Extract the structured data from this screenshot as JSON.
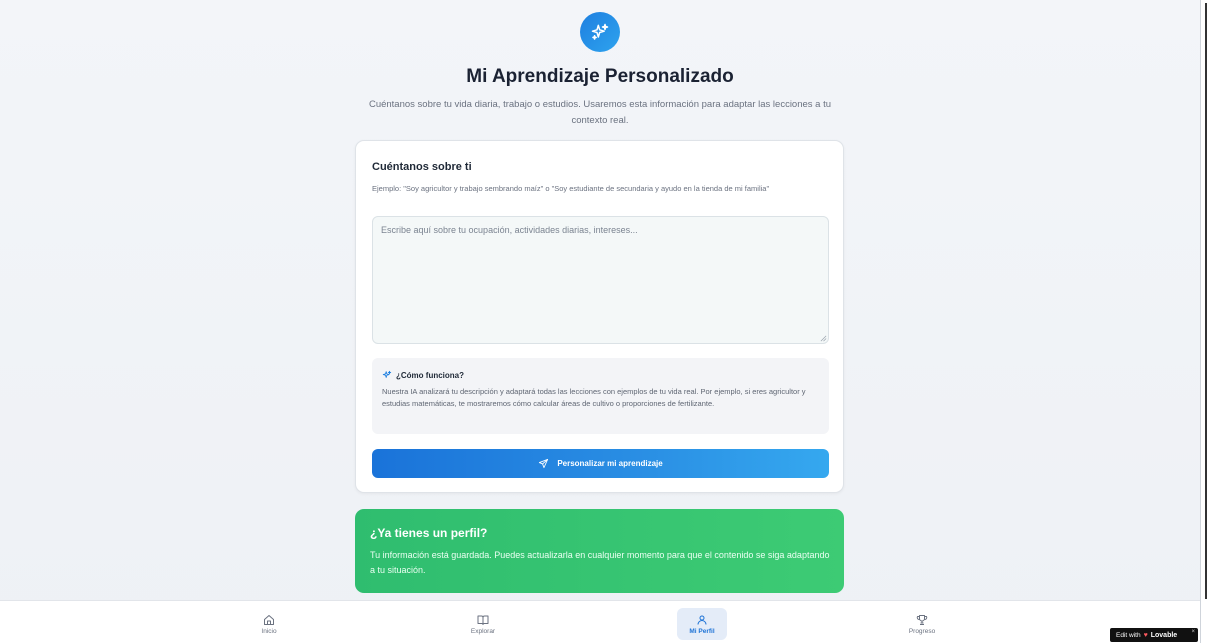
{
  "header": {
    "title": "Mi Aprendizaje Personalizado",
    "subtitle": "Cuéntanos sobre tu vida diaria, trabajo o estudios. Usaremos esta información para adaptar las lecciones a tu contexto real."
  },
  "form": {
    "title": "Cuéntanos sobre ti",
    "hint": "Ejemplo: \"Soy agricultor y trabajo sembrando maíz\" o \"Soy estudiante de secundaria y ayudo en la tienda de mi familia\"",
    "textarea_placeholder": "Escribe aquí sobre tu ocupación, actividades diarias, intereses...",
    "textarea_value": "",
    "info": {
      "title": "¿Cómo funciona?",
      "body": "Nuestra IA analizará tu descripción y adaptará todas las lecciones con ejemplos de tu vida real. Por ejemplo, si eres agricultor y estudias matemáticas, te mostraremos cómo calcular áreas de cultivo o proporciones de fertilizante."
    },
    "submit_label": "Personalizar mi aprendizaje"
  },
  "profile_card": {
    "title": "¿Ya tienes un perfil?",
    "body": "Tu información está guardada. Puedes actualizarla en cualquier momento para que el contenido se siga adaptando a tu situación."
  },
  "bottom_nav": {
    "items": [
      {
        "label": "Inicio",
        "icon": "home-icon",
        "active": false
      },
      {
        "label": "Explorar",
        "icon": "book-icon",
        "active": false
      },
      {
        "label": "Mi Perfil",
        "icon": "user-icon",
        "active": true
      },
      {
        "label": "Progreso",
        "icon": "trophy-icon",
        "active": false
      }
    ]
  },
  "badge": {
    "prefix": "Edit with",
    "brand": "Lovable",
    "close": "×"
  },
  "colors": {
    "accent": "#1e7fe0",
    "success": "#2fbd6f"
  }
}
